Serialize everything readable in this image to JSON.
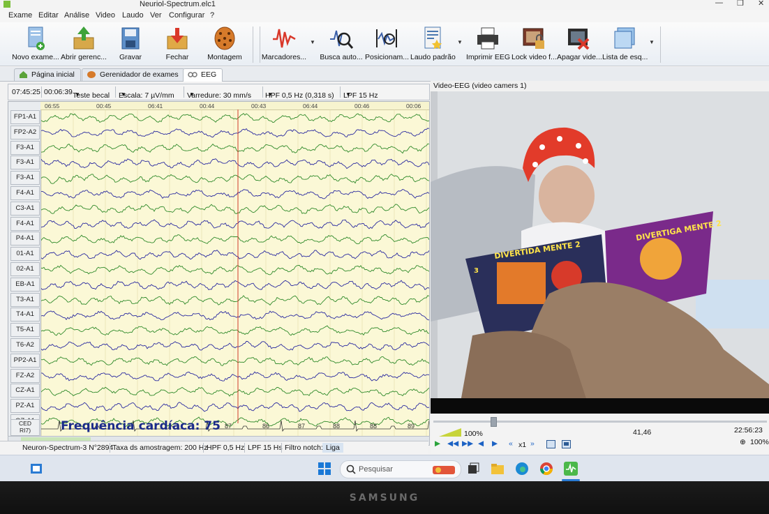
{
  "window": {
    "title": "Neuriol-Spectrum.elc1"
  },
  "menu": [
    "Exame",
    "Editar",
    "Análise",
    "Video",
    "Laudo",
    "Ver",
    "Configurar",
    "?"
  ],
  "toolbar": {
    "items": [
      {
        "label": "Novo exame...",
        "icon": "new-exam-icon"
      },
      {
        "label": "Abrir gerenc...",
        "icon": "open-manager-icon"
      },
      {
        "label": "Gravar",
        "icon": "save-icon"
      },
      {
        "label": "Fechar",
        "icon": "close-exam-icon"
      },
      {
        "label": "Montagem",
        "icon": "montage-icon"
      },
      {
        "label": "Marcadores...",
        "icon": "markers-icon"
      },
      {
        "label": "Busca auto...",
        "icon": "auto-search-icon"
      },
      {
        "label": "Posicionam...",
        "icon": "positioning-icon"
      },
      {
        "label": "Laudo padrão",
        "icon": "report-icon"
      },
      {
        "label": "Imprimir EEG",
        "icon": "printer-icon"
      },
      {
        "label": "Lock video f...",
        "icon": "lock-video-icon"
      },
      {
        "label": "Apagar vide...",
        "icon": "delete-video-icon"
      },
      {
        "label": "Lista de esq...",
        "icon": "list-icon"
      }
    ]
  },
  "tabs": [
    {
      "label": "Página inicial",
      "icon": "home-icon"
    },
    {
      "label": "Gerenidador de exames",
      "icon": "exam-manager-icon"
    },
    {
      "label": "EEG",
      "icon": "eeg-icon"
    }
  ],
  "eeg_toolbar": {
    "time": "07:45:25",
    "elapsed": "00:06:39",
    "test": "Teste becal",
    "scale": "Escala:  7 µV/mm",
    "sweep": "Varredure:  30 mm/s",
    "hpf": "HPF  0,5 Hz (0,318 s)",
    "lpf": "LPF  15 Hz"
  },
  "time_ruler": [
    "06:55",
    "00:45",
    "06:41",
    "00:44",
    "00:43",
    "06:44",
    "00:46",
    "00:06"
  ],
  "channels": [
    "FP1-A1",
    "FP2-A2",
    "F3-A1",
    "F3-A1",
    "F3-A1",
    "F4-A1",
    "C3-A1",
    "F4-A1",
    "P4-A1",
    "01-A1",
    "02-A1",
    "EB-A1",
    "T3-A1",
    "T4-A1",
    "T5-A1",
    "T6-A2",
    "PP2-A1",
    "FZ-A2",
    "CZ-A1",
    "PZ-A1",
    "OZ-A1"
  ],
  "ecg_label": "CED\nRI7)",
  "heart_rate_text": "Frequência cardíaca: 75",
  "ecg_numbers": [
    "87",
    "86",
    "87",
    "88",
    "88",
    "89"
  ],
  "status": {
    "device": "Neuron-Spectrum-3 N°2894",
    "sampling": "Taxa ds amostragem: 200 Hz",
    "hpf": "HPF  0,5 Hz",
    "lpf": "LPF  15 Hs",
    "notch_label": "Filtro notch:",
    "notch_value": "Liga"
  },
  "video": {
    "title": "Video-EEG (video camers 1)",
    "volume": "100%",
    "position": "41,46",
    "clock": "22:56:23",
    "zoom": "100%",
    "speed": "x1",
    "book_text_1": "DIVERTIGA MENTE 2",
    "book_text_2": "DIVERTIDA MENTE 2",
    "book_number": "3"
  },
  "taskbar": {
    "search_placeholder": "Pesquisar"
  },
  "monitor": {
    "brand": "SAMSUNG"
  },
  "colors": {
    "eeg_bg": "#fbf8d6",
    "trace_green": "#2f8a2a",
    "trace_blue": "#2a2aa0",
    "marker_red": "#d23a2a"
  }
}
